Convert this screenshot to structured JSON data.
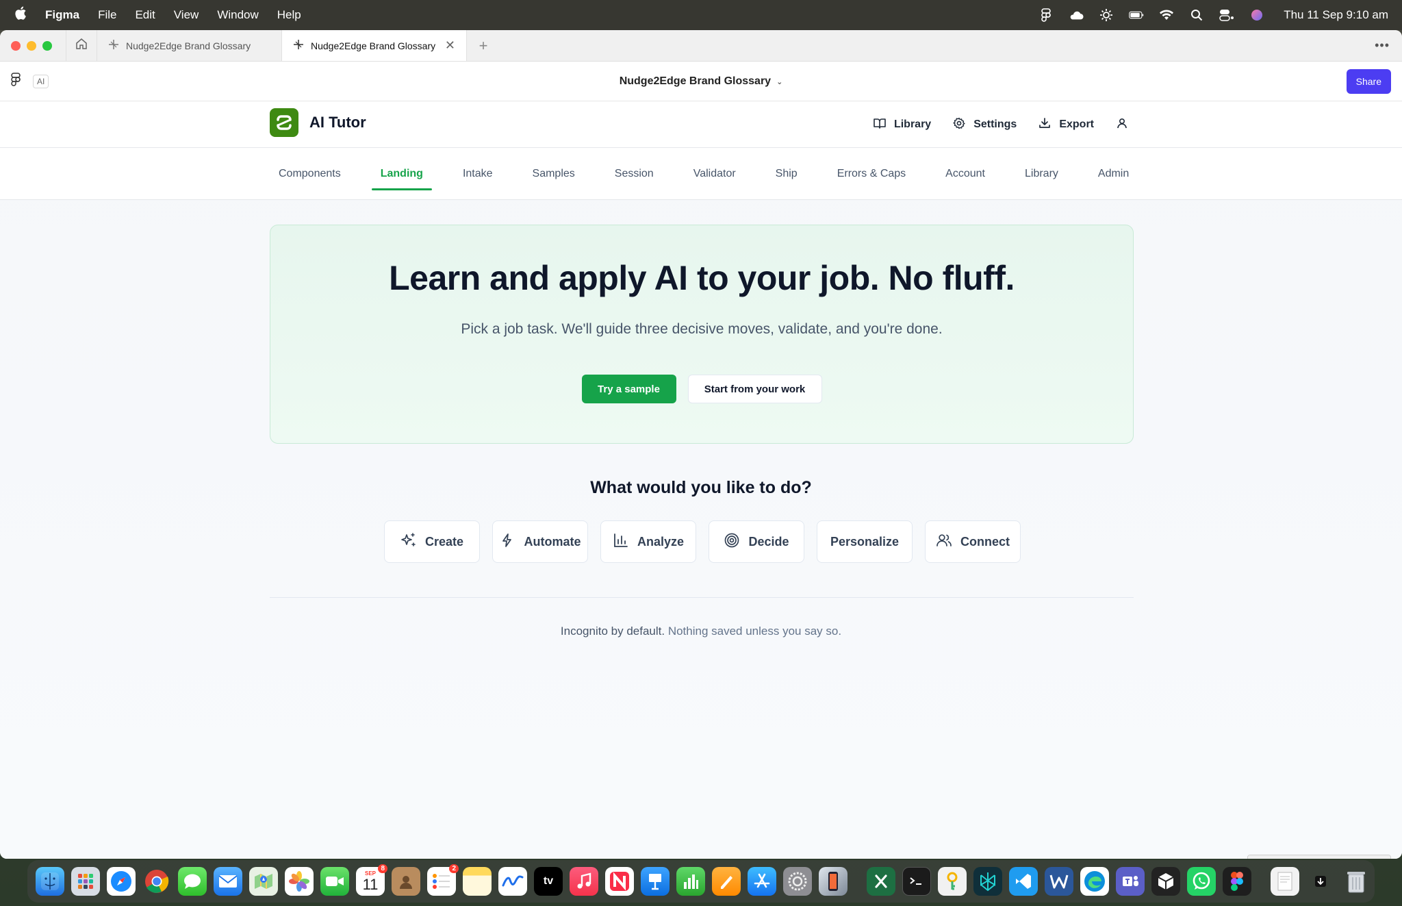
{
  "menubar": {
    "app": "Figma",
    "items": [
      "File",
      "Edit",
      "View",
      "Window",
      "Help"
    ],
    "clock": "Thu 11 Sep  9:10 am",
    "status_icons": [
      "figma-status-icon",
      "cloud-icon",
      "brightness-icon",
      "battery-icon",
      "wifi-icon",
      "search-icon",
      "control-center-icon",
      "siri-icon"
    ]
  },
  "browser": {
    "tabs": [
      {
        "label": "Nudge2Edge Brand Glossary",
        "active": false
      },
      {
        "label": "Nudge2Edge Brand Glossary",
        "active": true
      }
    ]
  },
  "figma": {
    "ai_label": "AI",
    "file_title": "Nudge2Edge Brand Glossary",
    "share_label": "Share",
    "accent": "#4c3df2"
  },
  "app": {
    "name": "AI Tutor",
    "brand_color": "#3e8a12",
    "accent": "#16a34a",
    "header_actions": [
      {
        "label": "Library",
        "icon": "book-icon"
      },
      {
        "label": "Settings",
        "icon": "gear-icon"
      },
      {
        "label": "Export",
        "icon": "download-icon"
      }
    ],
    "nav": [
      "Components",
      "Landing",
      "Intake",
      "Samples",
      "Session",
      "Validator",
      "Ship",
      "Errors & Caps",
      "Account",
      "Library",
      "Admin"
    ],
    "nav_active": "Landing"
  },
  "hero": {
    "title": "Learn and apply AI to your job. No fluff.",
    "subtitle": "Pick a job task. We'll guide three decisive moves, validate, and you're done.",
    "primary_cta": "Try a sample",
    "secondary_cta": "Start from your work"
  },
  "choices": {
    "title": "What would you like to do?",
    "items": [
      {
        "label": "Create",
        "icon": "sparkles-icon"
      },
      {
        "label": "Automate",
        "icon": "lightning-icon"
      },
      {
        "label": "Analyze",
        "icon": "bar-chart-icon"
      },
      {
        "label": "Decide",
        "icon": "target-icon"
      },
      {
        "label": "Personalize",
        "icon": ""
      },
      {
        "label": "Connect",
        "icon": "users-icon"
      }
    ]
  },
  "footer": {
    "strong": "Incognito by default.",
    "rest": " Nothing saved unless you say so."
  },
  "dock": {
    "calendar_month": "SEP",
    "calendar_day": "11",
    "calendar_badge": "8",
    "reminders_badge": "2",
    "tv_label": "tv"
  }
}
